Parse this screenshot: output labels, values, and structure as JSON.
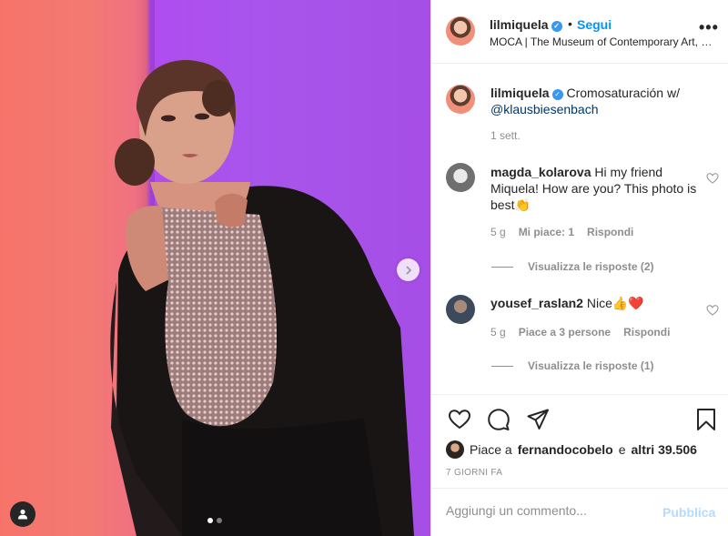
{
  "post": {
    "author": "lilmiquela",
    "verified_glyph": "✓",
    "bullet": "•",
    "follow_label": "Segui",
    "location": "MOCA | The Museum of Contemporary Art, Los Angeles",
    "more_glyph": "•••",
    "carousel": {
      "slides": 2,
      "active": 1
    }
  },
  "caption": {
    "username": "lilmiquela",
    "text": "Cromosaturación w/",
    "mention": "@klausbiesenbach",
    "age": "1 sett."
  },
  "comments": [
    {
      "username": "magda_kolarova",
      "text": "Hi my friend Miquela! How are you? This photo is best👏",
      "age": "5 g",
      "likes": "Mi piace: 1",
      "reply": "Rispondi",
      "view_replies": "Visualizza le risposte (2)"
    },
    {
      "username": "yousef_raslan2",
      "text": "Nice👍❤️",
      "age": "5 g",
      "likes": "Piace a 3 persone",
      "reply": "Rispondi",
      "view_replies": "Visualizza le risposte (1)"
    }
  ],
  "likes": {
    "prefix": "Piace a",
    "user": "fernandocobelo",
    "conj": "e",
    "others": "altri 39.506"
  },
  "timestamp": "7 GIORNI FA",
  "add_comment": {
    "placeholder": "Aggiungi un commento...",
    "publish_label": "Pubblica"
  },
  "icons": [
    "chevron-right-icon",
    "user-tag-icon",
    "heart-icon",
    "comment-icon",
    "share-icon",
    "bookmark-icon",
    "more-icon"
  ],
  "colors": {
    "link": "#0095f6",
    "mention": "#00376b",
    "muted": "#8e8e8e",
    "publish_disabled": "#b3dbff",
    "verified": "#3897f0"
  }
}
